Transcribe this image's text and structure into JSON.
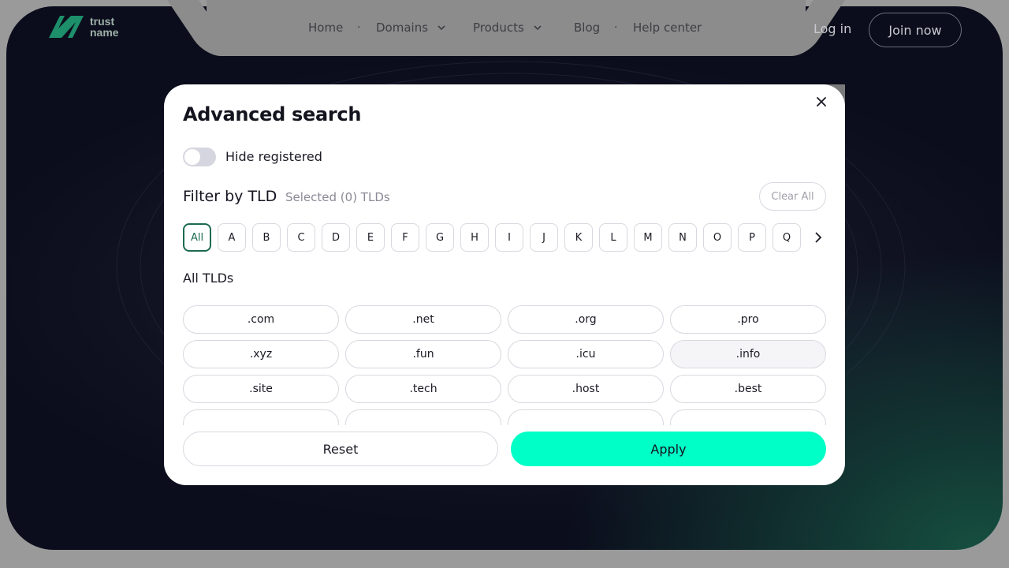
{
  "brand": {
    "name_line1": "trust",
    "name_line2": "name",
    "accent": "#00ffc6",
    "logo_color": "#1d8f6a"
  },
  "nav": {
    "items": [
      {
        "label": "Home",
        "has_dropdown": false
      },
      {
        "label": "Domains",
        "has_dropdown": true
      },
      {
        "label": "Products",
        "has_dropdown": true
      },
      {
        "label": "Blog",
        "has_dropdown": false
      },
      {
        "label": "Help center",
        "has_dropdown": false
      }
    ],
    "separator": "·",
    "login": "Log in",
    "join": "Join now"
  },
  "modal": {
    "title": "Advanced search",
    "close_icon": "close-icon",
    "hide_registered": {
      "label": "Hide registered",
      "enabled": false
    },
    "filter_title": "Filter by TLD",
    "selected_count": "Selected (0) TLDs",
    "clear_all": "Clear All",
    "letters": [
      "All",
      "A",
      "B",
      "C",
      "D",
      "E",
      "F",
      "G",
      "H",
      "I",
      "J",
      "K",
      "L",
      "M",
      "N",
      "O",
      "P",
      "Q"
    ],
    "active_letter": "All",
    "section_title": "All TLDs",
    "tlds": [
      ".com",
      ".net",
      ".org",
      ".pro",
      ".xyz",
      ".fun",
      ".icu",
      ".info",
      ".site",
      ".tech",
      ".host",
      ".best"
    ],
    "hovered_tld": ".info",
    "reset": "Reset",
    "apply": "Apply"
  }
}
